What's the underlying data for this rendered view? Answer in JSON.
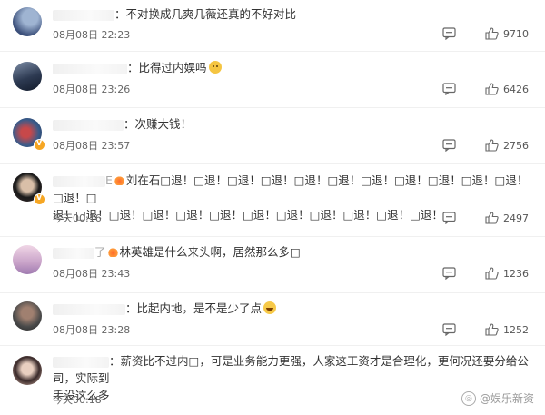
{
  "comments": [
    {
      "text": "不对换成几爽几薇还真的不好对比",
      "time": "08月08日 22:23",
      "likes": "9710",
      "avatar_colors": [
        "#3b4f7a",
        "#8aa0c0"
      ]
    },
    {
      "text": "比得过内娱吗",
      "time": "08月08日 23:26",
      "likes": "6426",
      "avatar_colors": [
        "#2d3a52",
        "#6d7e9a"
      ],
      "emoji": "cat-emoji"
    },
    {
      "text": "次赚大钱！",
      "time": "08月08日 23:57",
      "likes": "2756",
      "avatar_colors": [
        "#3a5b8a",
        "#c7484a"
      ],
      "badge": true
    },
    {
      "prefix_mark": "E",
      "line_a": "刘在石□退！□退！□退！□退！□退！□退！□退！□退！□退！□退！□退！□退！□",
      "line_b": "退！□退！□退！□退！□退！□退！□退！□退！□退！□退！□退！□退！",
      "time": "今天00:16",
      "likes": "2497",
      "avatar_colors": [
        "#1a1a1a",
        "#d9bfa8"
      ],
      "badge": true,
      "fire": true
    },
    {
      "prefix_mark": "了",
      "text": "林英雄是什么来头啊，居然那么多□",
      "time": "08月08日 23:43",
      "likes": "1236",
      "avatar_colors": [
        "#c9a3c9",
        "#f0d6e6"
      ],
      "fire": true
    },
    {
      "text": "比起内地，是不是少了点",
      "time": "08月08日 23:28",
      "likes": "1252",
      "avatar_colors": [
        "#4a4a4a",
        "#a08070"
      ],
      "emoji": "laugh-emoji"
    },
    {
      "line_a": "薪资比不过内□，可是业务能力更强，人家这工资才是合理化，更何况还要分给公司，实际到",
      "line_b": "手没这么多",
      "time": "今天00:18",
      "avatar_colors": [
        "#d8b7a8",
        "#3a2a2a"
      ]
    }
  ],
  "watermark": "@娱乐新资"
}
